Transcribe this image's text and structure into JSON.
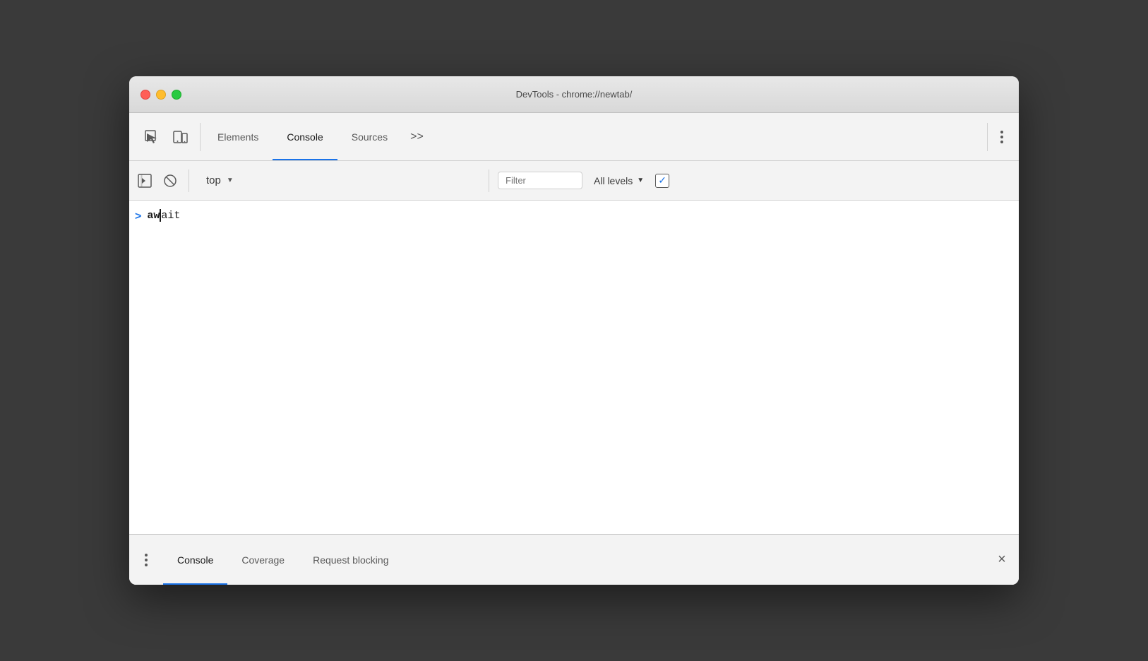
{
  "window": {
    "title": "DevTools - chrome://newtab/"
  },
  "traffic_lights": {
    "close_label": "close",
    "minimize_label": "minimize",
    "maximize_label": "maximize"
  },
  "top_toolbar": {
    "inspect_icon": "inspect-icon",
    "device_icon": "device-toolbar-icon",
    "tabs": [
      {
        "label": "Elements",
        "active": false
      },
      {
        "label": "Console",
        "active": true
      },
      {
        "label": "Sources",
        "active": false
      }
    ],
    "more_tabs_label": ">>",
    "more_options_label": "⋮"
  },
  "console_toolbar": {
    "sidebar_icon": "sidebar-icon",
    "clear_icon": "clear-console-icon",
    "context_label": "top",
    "filter_placeholder": "Filter",
    "levels_label": "All levels",
    "checkbox_checked": true
  },
  "console_content": {
    "entry": {
      "chevron": ">",
      "text_bold": "aw",
      "text_normal": "ait",
      "has_cursor": true
    }
  },
  "bottom_drawer": {
    "tabs": [
      {
        "label": "Console",
        "active": true
      },
      {
        "label": "Coverage",
        "active": false
      },
      {
        "label": "Request blocking",
        "active": false
      }
    ],
    "close_label": "×"
  }
}
